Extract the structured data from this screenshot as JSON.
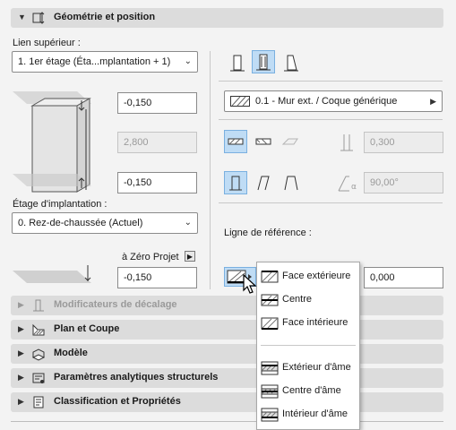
{
  "sections": {
    "geometry": {
      "title": "Géométrie et position",
      "expanded": true
    },
    "offset_modifiers": {
      "title": "Modificateurs de décalage",
      "disabled": true
    },
    "plan_section": {
      "title": "Plan et Coupe"
    },
    "model": {
      "title": "Modèle"
    },
    "structural": {
      "title": "Paramètres analytiques structurels"
    },
    "classification": {
      "title": "Classification et Propriétés"
    }
  },
  "left": {
    "top_link_label": "Lien supérieur :",
    "top_link_value": "1. 1er étage (Éta...mplantation + 1)",
    "top_offset": "-0,150",
    "height": "2,800",
    "bottom_offset": "-0,150",
    "home_story_label": "Étage d'implantation :",
    "home_story_value": "0. Rez-de-chaussée (Actuel)",
    "project_zero_label": "à Zéro Projet",
    "project_zero_value": "-0,150"
  },
  "right": {
    "composite_value": "0.1 - Mur ext. / Coque générique",
    "thickness": "0,300",
    "angle": "90,00°",
    "ref_line_label": "Ligne de référence :",
    "ref_offset": "0,000"
  },
  "ref_line_menu": {
    "items": [
      "Face extérieure",
      "Centre",
      "Face intérieure"
    ],
    "core_items": [
      "Extérieur d'âme",
      "Centre d'âme",
      "Intérieur d'âme"
    ]
  },
  "colors": {
    "accent": "#bfdcf5",
    "header": "#dcdcdc",
    "background": "#f3f3f3"
  }
}
